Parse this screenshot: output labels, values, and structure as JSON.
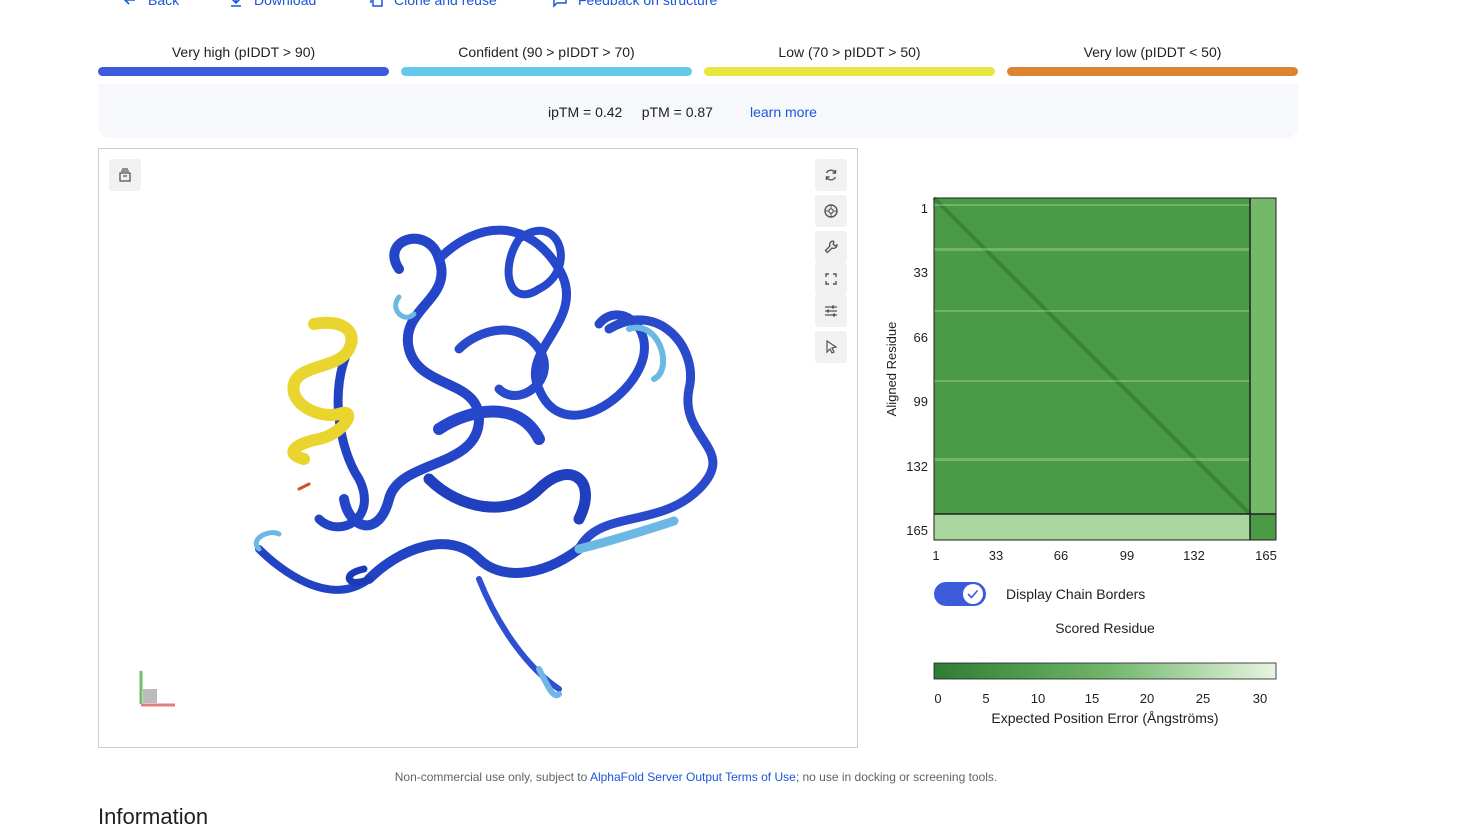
{
  "actions": {
    "back": "Back",
    "download": "Download",
    "clone": "Clone and reuse",
    "feedback": "Feedback on structure"
  },
  "plddt_legend": [
    {
      "label": "Very high (pIDDT > 90)",
      "color": "#3b5bdb"
    },
    {
      "label": "Confident (90 > pIDDT > 70)",
      "color": "#66c8e8"
    },
    {
      "label": "Low (70 > pIDDT > 50)",
      "color": "#eae640"
    },
    {
      "label": "Very low (pIDDT < 50)",
      "color": "#dd8432"
    }
  ],
  "scores": {
    "text": "ipTM = 0.42     pTM = 0.87",
    "learn_more": "learn more"
  },
  "pae": {
    "ylabel": "Aligned Residue",
    "xlabel": "Scored Residue",
    "y_ticks": [
      "1",
      "33",
      "66",
      "99",
      "132",
      "165"
    ],
    "x_ticks": [
      "1",
      "33",
      "66",
      "99",
      "132",
      "165"
    ],
    "toggle_label": "Display Chain Borders",
    "toggle_on": true,
    "colorbar_ticks": [
      "0",
      "5",
      "10",
      "15",
      "20",
      "25",
      "30"
    ],
    "colorbar_label": "Expected Position Error (Ångströms)",
    "colors": {
      "low": "#2e7d32",
      "high": "#e8f5e1"
    }
  },
  "footer": {
    "prefix": "Non-commercial use only, subject to ",
    "link": "AlphaFold Server Output Terms of Use",
    "suffix": "; no use in docking or screening tools."
  },
  "next_section": "Information"
}
